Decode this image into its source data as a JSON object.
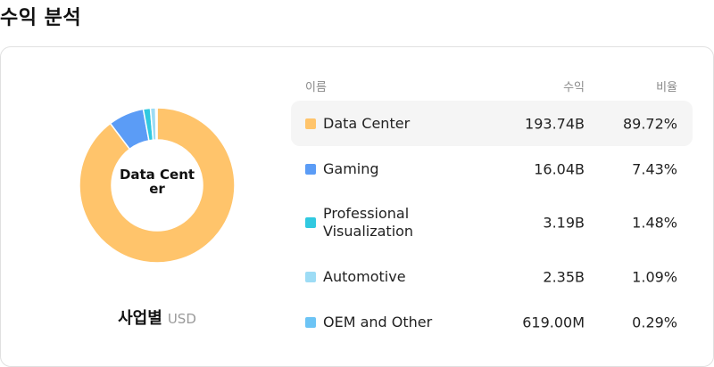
{
  "page": {
    "title": "수익 분석"
  },
  "donut": {
    "center_label": "Data Center"
  },
  "caption": {
    "main": "사업별",
    "unit": "USD"
  },
  "table": {
    "headers": {
      "name": "이름",
      "revenue": "수익",
      "ratio": "비율"
    },
    "rows": [
      {
        "name": "Data Center",
        "revenue": "193.74B",
        "ratio": "89.72%",
        "color": "#FFC46B"
      },
      {
        "name": "Gaming",
        "revenue": "16.04B",
        "ratio": "7.43%",
        "color": "#5B9CF6"
      },
      {
        "name": "Professional Visualization",
        "revenue": "3.19B",
        "ratio": "1.48%",
        "color": "#31C9E0"
      },
      {
        "name": "Automotive",
        "revenue": "2.35B",
        "ratio": "1.09%",
        "color": "#9DDCF5"
      },
      {
        "name": "OEM and Other",
        "revenue": "619.00M",
        "ratio": "0.29%",
        "color": "#6CC4F5"
      }
    ]
  },
  "chart_data": {
    "type": "pie",
    "categories": [
      "Data Center",
      "Gaming",
      "Professional Visualization",
      "Automotive",
      "OEM and Other"
    ],
    "values": [
      89.72,
      7.43,
      1.48,
      1.09,
      0.29
    ],
    "colors": [
      "#FFC46B",
      "#5B9CF6",
      "#31C9E0",
      "#9DDCF5",
      "#6CC4F5"
    ],
    "title": ""
  }
}
